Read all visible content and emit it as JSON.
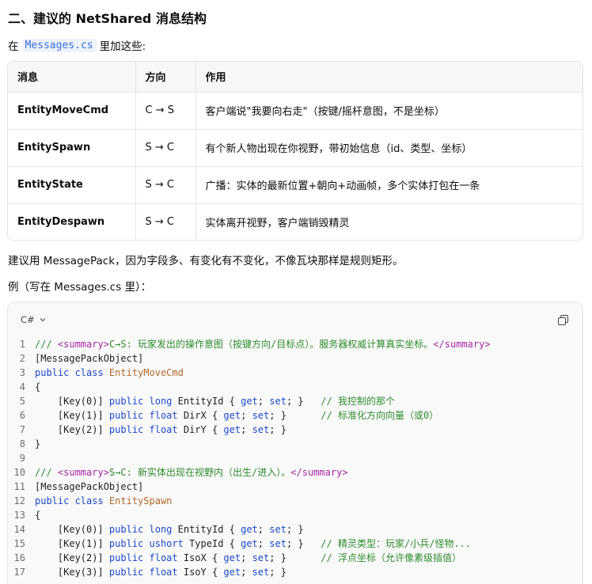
{
  "heading": "二、建议的 NetShared 消息结构",
  "intro": {
    "prefix": "在",
    "code": "Messages.cs",
    "suffix": "里加这些:"
  },
  "table": {
    "headers": [
      "消息",
      "方向",
      "作用"
    ],
    "rows": [
      [
        "EntityMoveCmd",
        "C → S",
        "客户端说\"我要向右走\"（按键/摇杆意图，不是坐标）"
      ],
      [
        "EntitySpawn",
        "S → C",
        "有个新人物出现在你视野，带初始信息（id、类型、坐标）"
      ],
      [
        "EntityState",
        "S → C",
        "广播：实体的最新位置+朝向+动画帧，多个实体打包在一条"
      ],
      [
        "EntityDespawn",
        "S → C",
        "实体离开视野，客户端销毁精灵"
      ]
    ]
  },
  "recommendation": "建议用 MessagePack，因为字段多、有变化有不变化，不像瓦块那样是规则矩形。",
  "example_label": "例（写在 Messages.cs 里）：",
  "code_block": {
    "language": "C#",
    "lines": [
      [
        [
          "cm",
          "/// "
        ],
        [
          "tag",
          "<summary>"
        ],
        [
          "cm",
          "C→S: 玩家发出的操作意图（按键方向/目标点）。服务器权威计算真实坐标。"
        ],
        [
          "tag",
          "</summary>"
        ]
      ],
      [
        [
          "src",
          "[MessagePackObject]"
        ]
      ],
      [
        [
          "kw",
          "public class "
        ],
        [
          "ty",
          "EntityMoveCmd"
        ]
      ],
      [
        [
          "src",
          "{"
        ]
      ],
      [
        [
          "src",
          "    [Key(0)] "
        ],
        [
          "kw",
          "public long "
        ],
        [
          "src",
          "EntityId { "
        ],
        [
          "kw",
          "get"
        ],
        [
          "src",
          "; "
        ],
        [
          "kw",
          "set"
        ],
        [
          "src",
          "; }   "
        ],
        [
          "cm",
          "// 我控制的那个"
        ]
      ],
      [
        [
          "src",
          "    [Key(1)] "
        ],
        [
          "kw",
          "public float "
        ],
        [
          "src",
          "DirX { "
        ],
        [
          "kw",
          "get"
        ],
        [
          "src",
          "; "
        ],
        [
          "kw",
          "set"
        ],
        [
          "src",
          "; }      "
        ],
        [
          "cm",
          "// 标准化方向向量（或0）"
        ]
      ],
      [
        [
          "src",
          "    [Key(2)] "
        ],
        [
          "kw",
          "public float "
        ],
        [
          "src",
          "DirY { "
        ],
        [
          "kw",
          "get"
        ],
        [
          "src",
          "; "
        ],
        [
          "kw",
          "set"
        ],
        [
          "src",
          "; }"
        ]
      ],
      [
        [
          "src",
          "}"
        ]
      ],
      [
        [
          "src",
          ""
        ]
      ],
      [
        [
          "cm",
          "/// "
        ],
        [
          "tag",
          "<summary>"
        ],
        [
          "cm",
          "S→C: 新实体出现在视野内（出生/进入）。"
        ],
        [
          "tag",
          "</summary>"
        ]
      ],
      [
        [
          "src",
          "[MessagePackObject]"
        ]
      ],
      [
        [
          "kw",
          "public class "
        ],
        [
          "ty",
          "EntitySpawn"
        ]
      ],
      [
        [
          "src",
          "{"
        ]
      ],
      [
        [
          "src",
          "    [Key(0)] "
        ],
        [
          "kw",
          "public long "
        ],
        [
          "src",
          "EntityId { "
        ],
        [
          "kw",
          "get"
        ],
        [
          "src",
          "; "
        ],
        [
          "kw",
          "set"
        ],
        [
          "src",
          "; }"
        ]
      ],
      [
        [
          "src",
          "    [Key(1)] "
        ],
        [
          "kw",
          "public ushort "
        ],
        [
          "src",
          "TypeId { "
        ],
        [
          "kw",
          "get"
        ],
        [
          "src",
          "; "
        ],
        [
          "kw",
          "set"
        ],
        [
          "src",
          "; }   "
        ],
        [
          "cm",
          "// 精灵类型：玩家/小兵/怪物..."
        ]
      ],
      [
        [
          "src",
          "    [Key(2)] "
        ],
        [
          "kw",
          "public float "
        ],
        [
          "src",
          "IsoX { "
        ],
        [
          "kw",
          "get"
        ],
        [
          "src",
          "; "
        ],
        [
          "kw",
          "set"
        ],
        [
          "src",
          "; }      "
        ],
        [
          "cm",
          "// 浮点坐标（允许像素级插值）"
        ]
      ],
      [
        [
          "src",
          "    [Key(3)] "
        ],
        [
          "kw",
          "public float "
        ],
        [
          "src",
          "IsoY { "
        ],
        [
          "kw",
          "get"
        ],
        [
          "src",
          "; "
        ],
        [
          "kw",
          "set"
        ],
        [
          "src",
          "; }"
        ]
      ]
    ]
  }
}
